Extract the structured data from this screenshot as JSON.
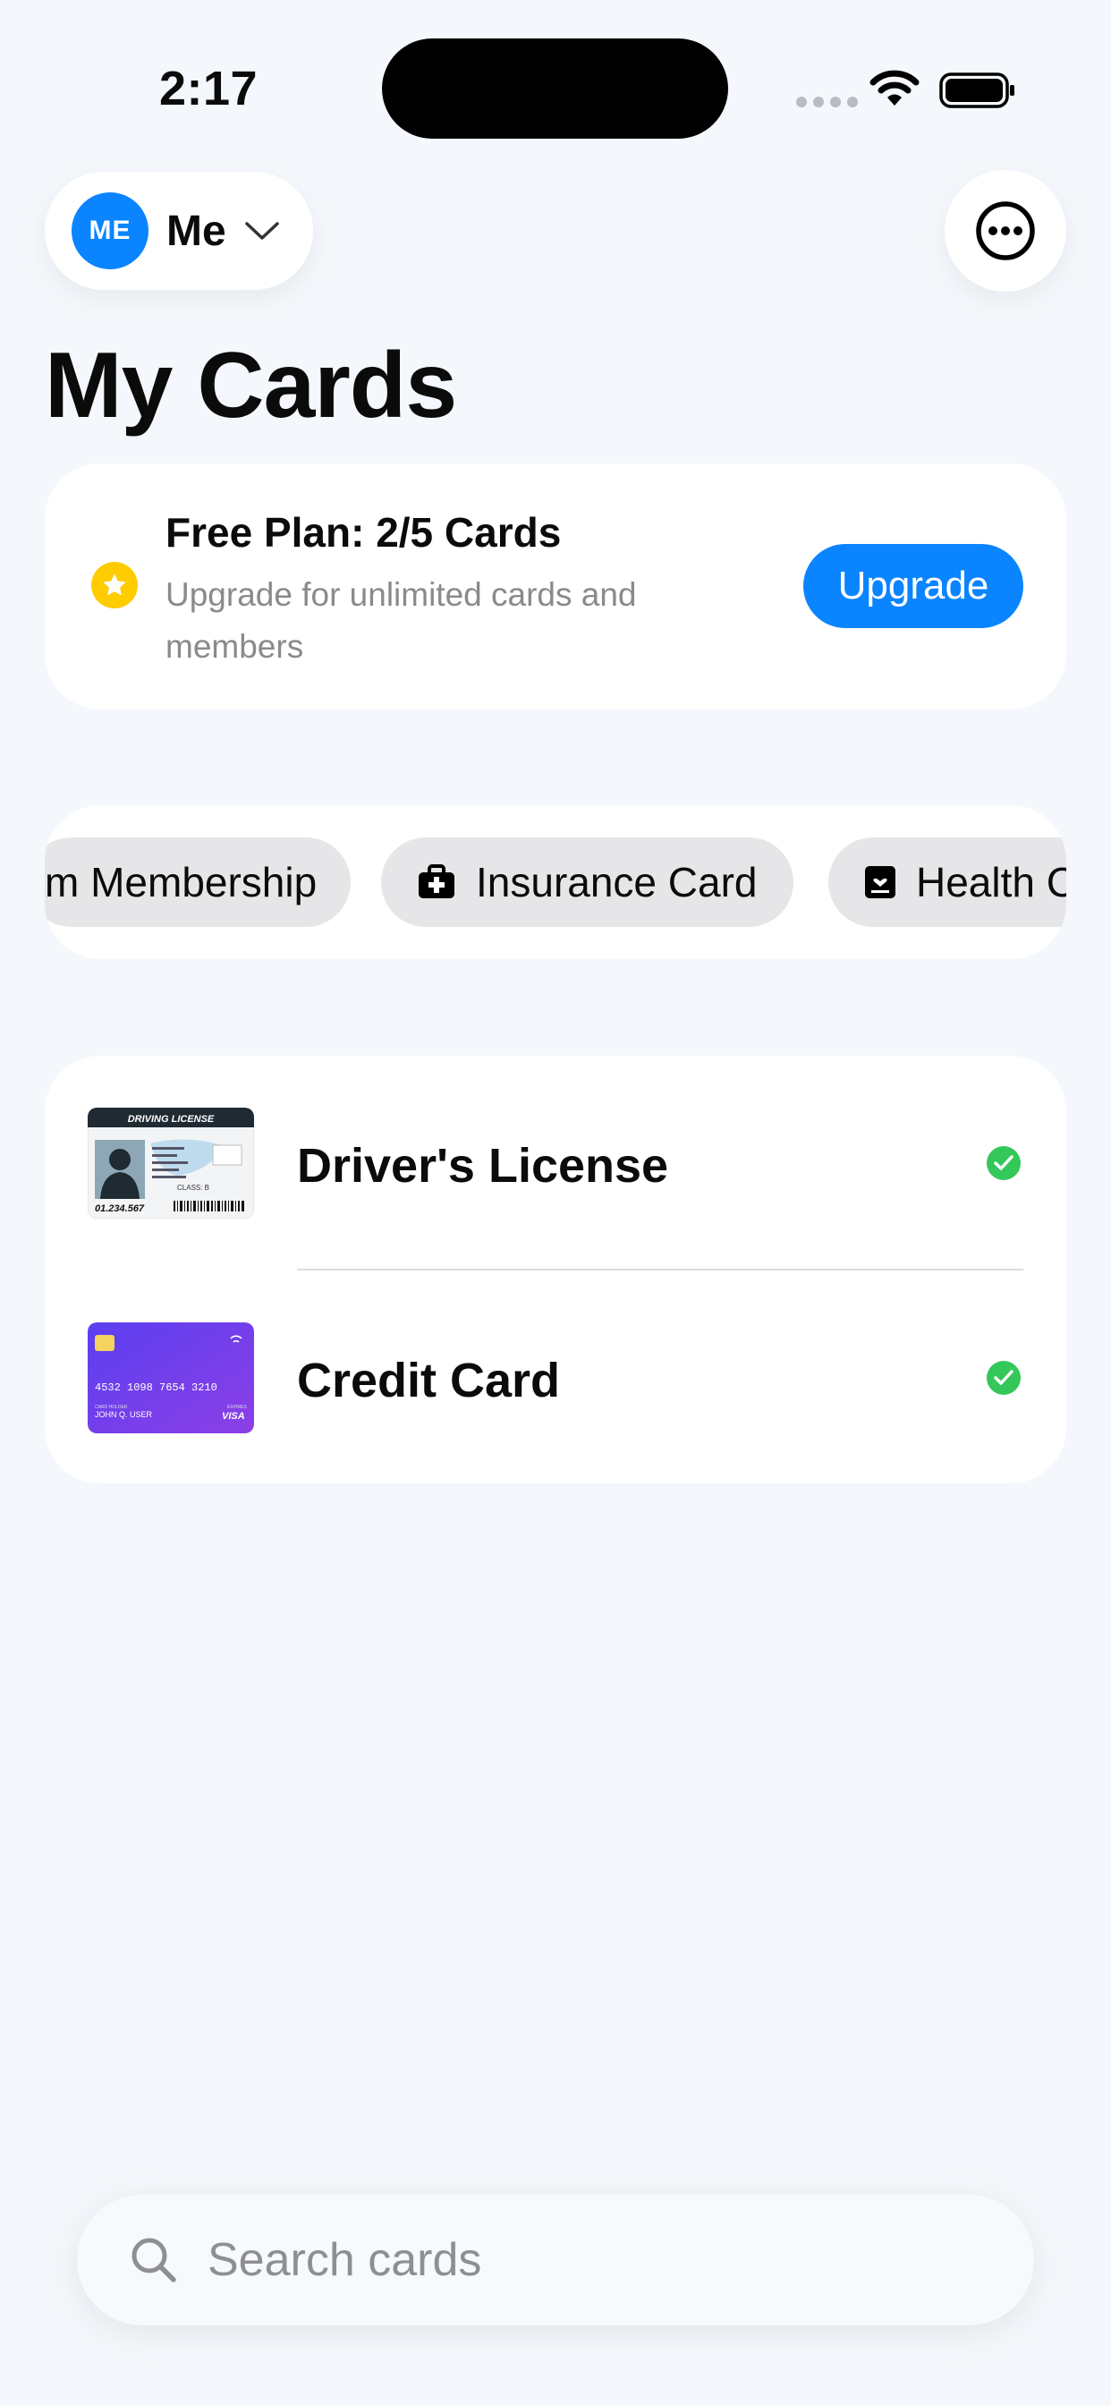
{
  "status_bar": {
    "time": "2:17"
  },
  "profile": {
    "initials": "ME",
    "name": "Me"
  },
  "page": {
    "title": "My Cards"
  },
  "plan": {
    "title": "Free Plan: 2/5 Cards",
    "subtitle": "Upgrade for unlimited cards and members",
    "upgrade_label": "Upgrade"
  },
  "categories": [
    {
      "label": "m Membership",
      "icon": "none"
    },
    {
      "label": "Insurance Card",
      "icon": "medkit-icon"
    },
    {
      "label": "Health C",
      "icon": "health-card-icon"
    }
  ],
  "cards": [
    {
      "name": "Driver's License",
      "verified": true,
      "thumb": {
        "header": "DRIVING LICENSE",
        "number": "01.234.567",
        "class": "CLASS: B"
      }
    },
    {
      "name": "Credit Card",
      "verified": true,
      "thumb": {
        "number": "4532 1098 7654 3210",
        "holder_caption": "CARD HOLDER",
        "holder": "JOHN Q. USER",
        "expiry_caption": "EXPIRES",
        "brand": "VISA"
      }
    }
  ],
  "search": {
    "placeholder": "Search cards"
  },
  "colors": {
    "accent": "#0a84ff",
    "verified": "#34c759",
    "star": "#ffcc00",
    "card_purple": "#6a3df0"
  }
}
